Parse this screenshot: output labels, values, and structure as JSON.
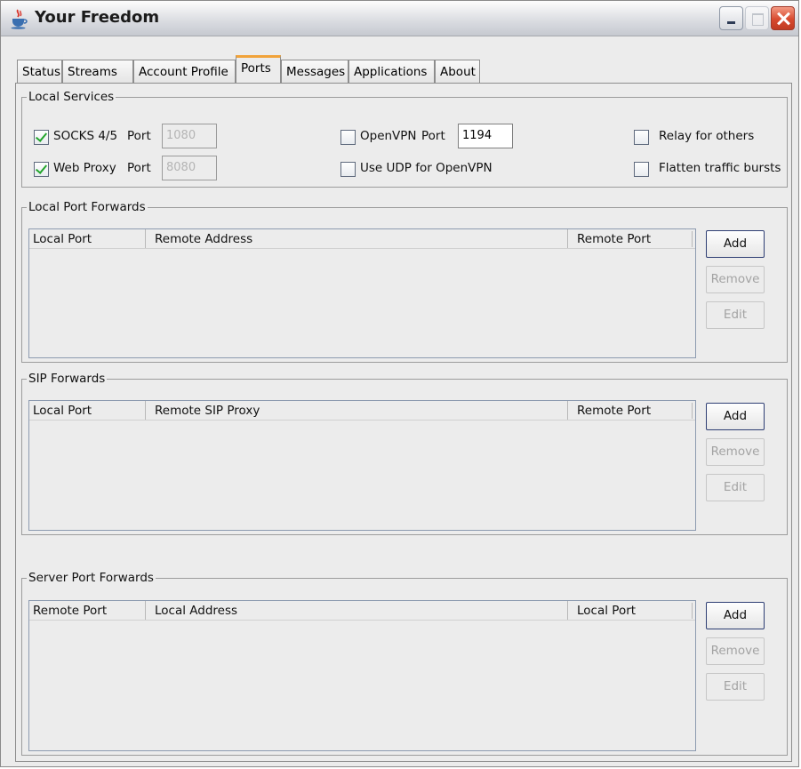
{
  "window": {
    "title": "Your Freedom",
    "app_icon": "java-cup-icon",
    "controls": [
      "minimize-icon",
      "maximize-icon",
      "close-icon"
    ]
  },
  "tabs": [
    {
      "label": "Status",
      "active": false
    },
    {
      "label": "Streams",
      "active": false
    },
    {
      "label": "Account Profile",
      "active": false
    },
    {
      "label": "Ports",
      "active": true
    },
    {
      "label": "Messages",
      "active": false
    },
    {
      "label": "Applications",
      "active": false
    },
    {
      "label": "About",
      "active": false
    }
  ],
  "local_services": {
    "title": "Local Services",
    "socks": {
      "label": "SOCKS 4/5",
      "checked": true,
      "port_label": "Port",
      "port_value": "1080",
      "port_enabled": false
    },
    "web_proxy": {
      "label": "Web Proxy",
      "checked": true,
      "port_label": "Port",
      "port_value": "8080",
      "port_enabled": false
    },
    "openvpn": {
      "label": "OpenVPN",
      "checked": false,
      "port_label": "Port",
      "port_value": "1194",
      "port_enabled": true
    },
    "udp_openvpn": {
      "label": "Use UDP for OpenVPN",
      "checked": false
    },
    "relay": {
      "label": "Relay for others",
      "checked": false
    },
    "flatten": {
      "label": "Flatten traffic bursts",
      "checked": false
    }
  },
  "local_port_forwards": {
    "title": "Local Port Forwards",
    "columns": [
      "Local Port",
      "Remote Address",
      "Remote Port"
    ],
    "rows": [],
    "buttons": {
      "add": "Add",
      "remove": "Remove",
      "edit": "Edit"
    }
  },
  "sip_forwards": {
    "title": "SIP Forwards",
    "columns": [
      "Local Port",
      "Remote SIP Proxy",
      "Remote Port"
    ],
    "rows": [],
    "buttons": {
      "add": "Add",
      "remove": "Remove",
      "edit": "Edit"
    }
  },
  "server_port_forwards": {
    "title": "Server Port Forwards",
    "columns": [
      "Remote Port",
      "Local Address",
      "Local Port"
    ],
    "rows": [],
    "buttons": {
      "add": "Add",
      "remove": "Remove",
      "edit": "Edit"
    }
  },
  "colors": {
    "active_tab_accent": "#f1a33a",
    "check_mark": "#22a52c",
    "close_button": "#d74a2f"
  }
}
